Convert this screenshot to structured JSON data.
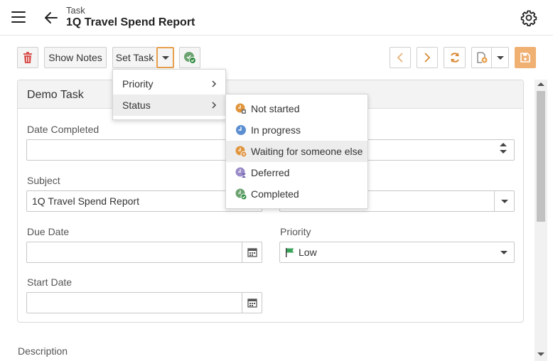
{
  "header": {
    "kicker": "Task",
    "title": "1Q Travel Spend Report"
  },
  "toolbar": {
    "show_notes": "Show Notes",
    "set_task": "Set Task"
  },
  "card": {
    "title": "Demo Task",
    "fields": {
      "date_completed": {
        "label": "Date Completed",
        "value": ""
      },
      "subject": {
        "label": "Subject",
        "value": "1Q Travel Spend Report"
      },
      "due_date": {
        "label": "Due Date",
        "value": ""
      },
      "priority": {
        "label": "Priority",
        "value": "Low"
      },
      "start_date": {
        "label": "Start Date",
        "value": ""
      }
    }
  },
  "description_label": "Description",
  "set_task_menu": {
    "items": [
      {
        "label": "Priority"
      },
      {
        "label": "Status"
      }
    ]
  },
  "status_menu": {
    "items": [
      {
        "label": "Not started",
        "icon": "not-started-icon"
      },
      {
        "label": "In progress",
        "icon": "in-progress-icon"
      },
      {
        "label": "Waiting for someone else",
        "icon": "waiting-icon"
      },
      {
        "label": "Deferred",
        "icon": "deferred-icon"
      },
      {
        "label": "Completed",
        "icon": "completed-icon"
      }
    ]
  },
  "colors": {
    "accent_orange": "#e8a04c",
    "delete_red": "#d9534f",
    "complete_green": "#3a9a4a",
    "flag_green": "#3aa35a"
  }
}
